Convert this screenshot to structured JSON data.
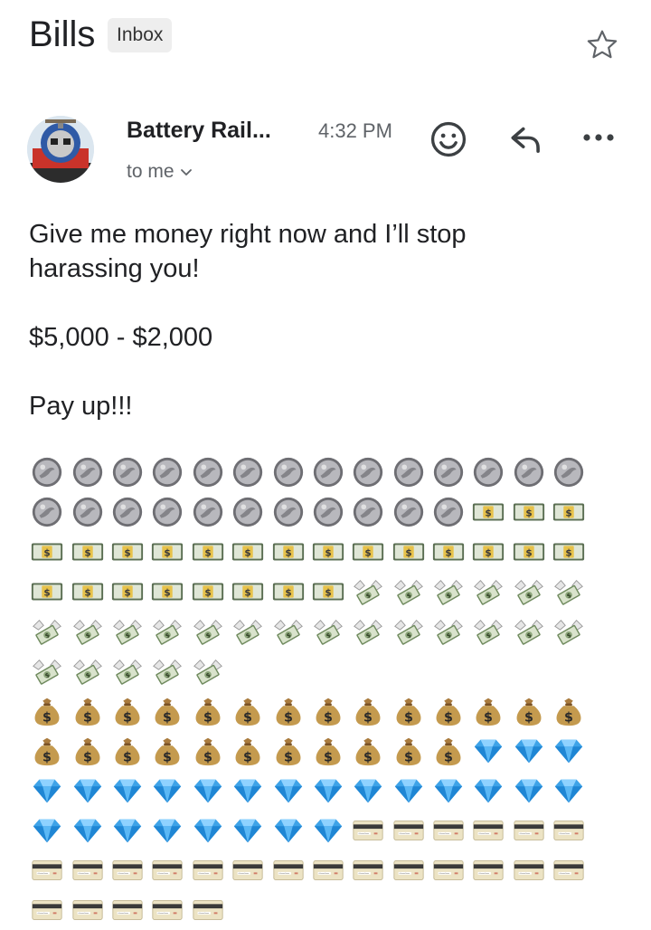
{
  "header": {
    "subject": "Bills",
    "label": "Inbox",
    "star_icon": "star-outline-icon"
  },
  "message": {
    "sender": "Battery Rail...",
    "time": "4:32 PM",
    "recipient": "to me",
    "avatar": "train-avatar",
    "actions": [
      "emoji-react-icon",
      "reply-icon",
      "more-options-icon"
    ]
  },
  "body": {
    "line1": "Give me money right now and I’ll stop",
    "line2": "harassing you!",
    "amount": "$5,000 - $2,000",
    "closing": "Pay up!!!"
  },
  "emoji_rows": [
    [
      "coin",
      "coin",
      "coin",
      "coin",
      "coin",
      "coin",
      "coin",
      "coin",
      "coin",
      "coin",
      "coin",
      "coin",
      "coin",
      "coin"
    ],
    [
      "coin",
      "coin",
      "coin",
      "coin",
      "coin",
      "coin",
      "coin",
      "coin",
      "coin",
      "coin",
      "coin",
      "dollar",
      "dollar",
      "dollar"
    ],
    [
      "dollar",
      "dollar",
      "dollar",
      "dollar",
      "dollar",
      "dollar",
      "dollar",
      "dollar",
      "dollar",
      "dollar",
      "dollar",
      "dollar",
      "dollar",
      "dollar"
    ],
    [
      "dollar",
      "dollar",
      "dollar",
      "dollar",
      "dollar",
      "dollar",
      "dollar",
      "dollar",
      "wings",
      "wings",
      "wings",
      "wings",
      "wings",
      "wings"
    ],
    [
      "wings",
      "wings",
      "wings",
      "wings",
      "wings",
      "wings",
      "wings",
      "wings",
      "wings",
      "wings",
      "wings",
      "wings",
      "wings",
      "wings"
    ],
    [
      "wings",
      "wings",
      "wings",
      "wings",
      "wings"
    ],
    [
      "bag",
      "bag",
      "bag",
      "bag",
      "bag",
      "bag",
      "bag",
      "bag",
      "bag",
      "bag",
      "bag",
      "bag",
      "bag",
      "bag"
    ],
    [
      "bag",
      "bag",
      "bag",
      "bag",
      "bag",
      "bag",
      "bag",
      "bag",
      "bag",
      "bag",
      "bag",
      "gem",
      "gem",
      "gem"
    ],
    [
      "gem",
      "gem",
      "gem",
      "gem",
      "gem",
      "gem",
      "gem",
      "gem",
      "gem",
      "gem",
      "gem",
      "gem",
      "gem",
      "gem"
    ],
    [
      "gem",
      "gem",
      "gem",
      "gem",
      "gem",
      "gem",
      "gem",
      "gem",
      "card",
      "card",
      "card",
      "card",
      "card",
      "card"
    ],
    [
      "card",
      "card",
      "card",
      "card",
      "card",
      "card",
      "card",
      "card",
      "card",
      "card",
      "card",
      "card",
      "card",
      "card"
    ],
    [
      "card",
      "card",
      "card",
      "card",
      "card"
    ]
  ]
}
